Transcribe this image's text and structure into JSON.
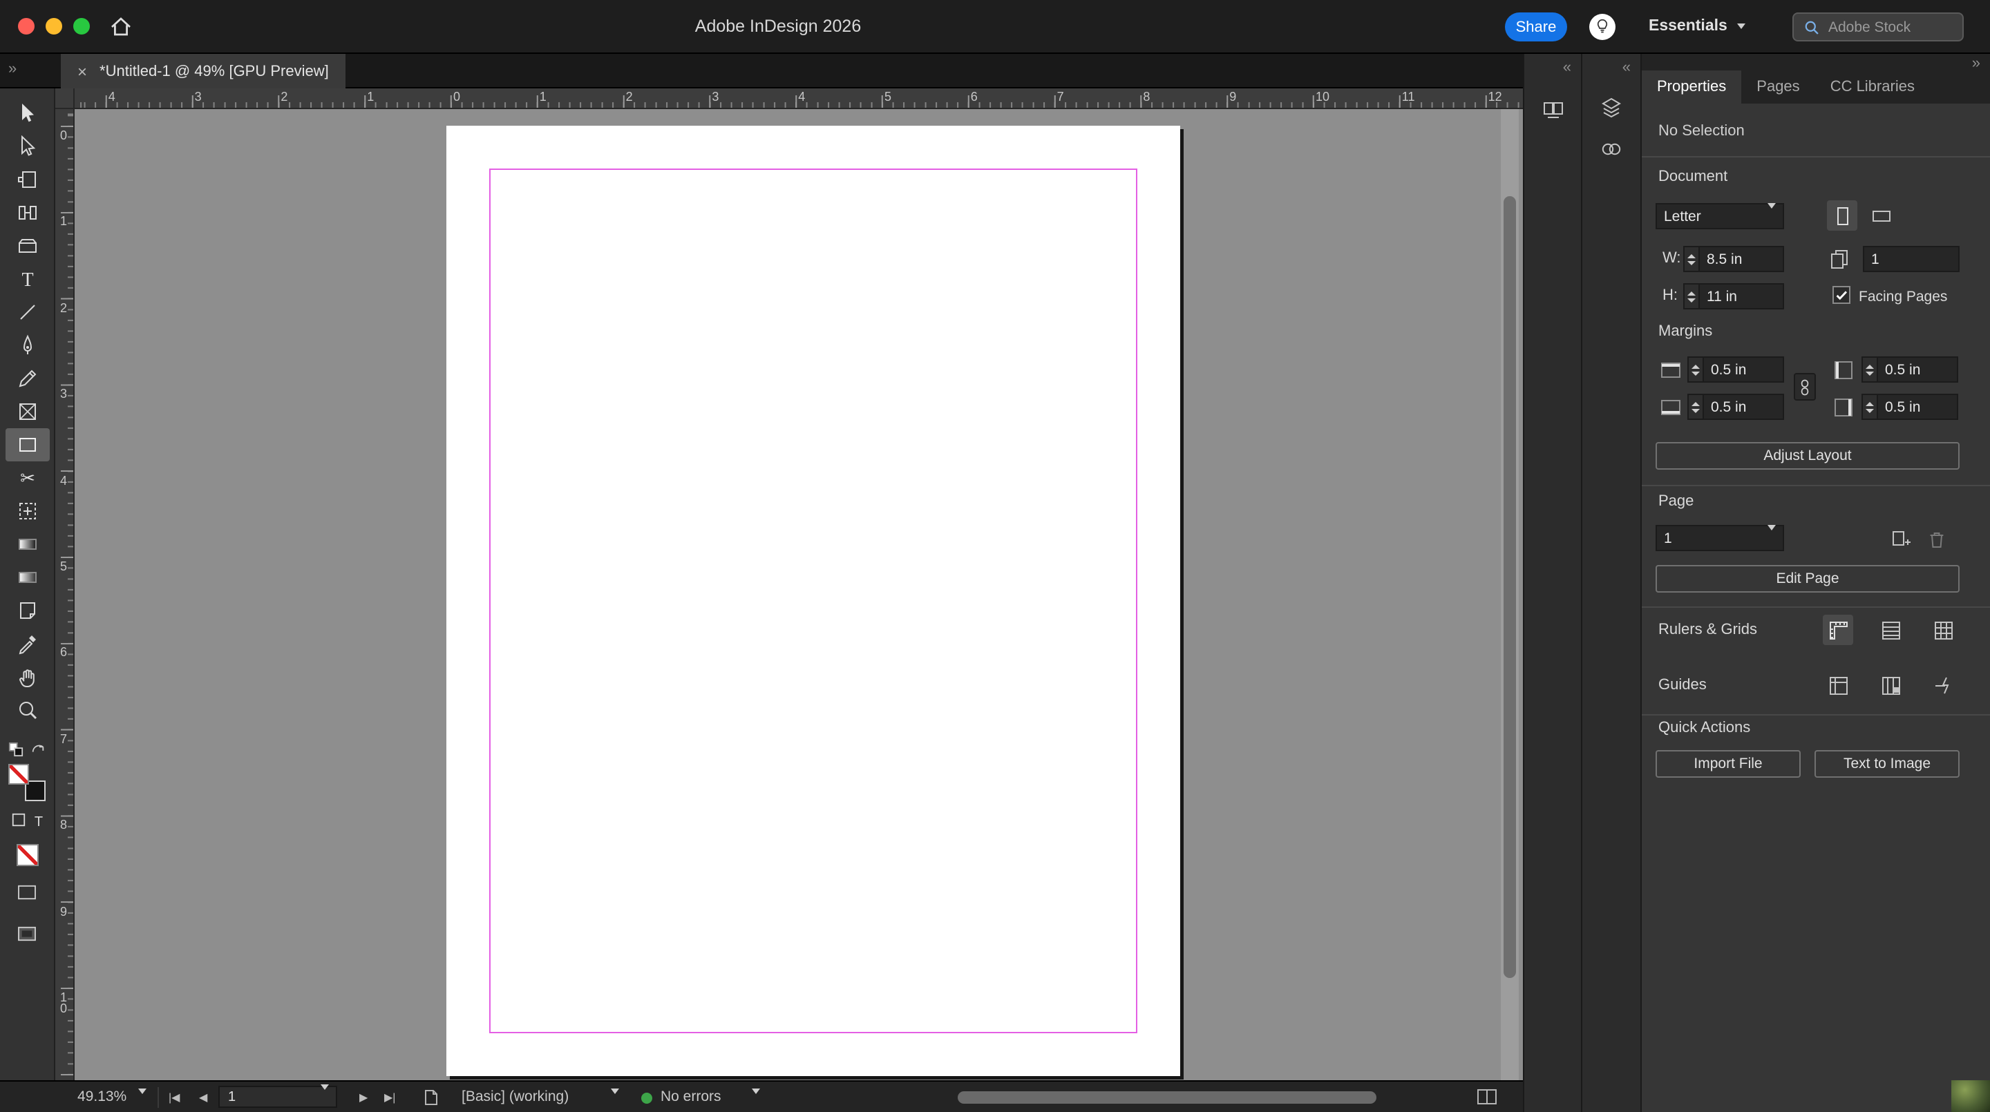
{
  "titlebar": {
    "title": "Adobe InDesign 2026",
    "share": "Share",
    "workspace": "Essentials",
    "stock_search_placeholder": "Adobe Stock"
  },
  "tabbar": {
    "document_tab": "*Untitled-1 @ 49% [GPU Preview]"
  },
  "icons": {
    "close-icon": "×",
    "dock-expand-icon": "»",
    "dock-collapse-icon": "«",
    "first-page-icon": "|◀",
    "prev-page-icon": "◀",
    "next-page-icon": "▶",
    "last-page-icon": "▶|"
  },
  "colors": {
    "accent_blue": "#1473e6",
    "margin_guide_magenta": "#e45fe4",
    "no_errors_green": "#3da549"
  },
  "toolbar": {
    "tools": [
      {
        "name": "selection-tool",
        "selected": false
      },
      {
        "name": "direct-selection-tool",
        "selected": false
      },
      {
        "name": "page-tool",
        "selected": false
      },
      {
        "name": "gap-tool",
        "selected": false
      },
      {
        "name": "content-collector-tool",
        "selected": false
      },
      {
        "name": "type-tool",
        "selected": false
      },
      {
        "name": "line-tool",
        "selected": false
      },
      {
        "name": "pen-tool",
        "selected": false
      },
      {
        "name": "pencil-tool",
        "selected": false
      },
      {
        "name": "rectangle-frame-tool",
        "selected": false
      },
      {
        "name": "rectangle-tool",
        "selected": true
      },
      {
        "name": "scissors-tool",
        "selected": false
      },
      {
        "name": "free-transform-tool",
        "selected": false
      },
      {
        "name": "gradient-swatch-tool",
        "selected": false
      },
      {
        "name": "gradient-feather-tool",
        "selected": false
      },
      {
        "name": "note-tool",
        "selected": false
      },
      {
        "name": "color-theme-tool",
        "selected": false
      },
      {
        "name": "hand-tool",
        "selected": false
      },
      {
        "name": "zoom-tool",
        "selected": false
      }
    ],
    "formatting_affects_text_glyph": "T"
  },
  "rulers": {
    "horizontal_labels": [
      "4",
      "3",
      "2",
      "1",
      "0",
      "1",
      "2",
      "3",
      "4",
      "5",
      "6",
      "7",
      "8",
      "9",
      "10",
      "11",
      "12"
    ],
    "vertical_labels": [
      "0",
      "1",
      "2",
      "3",
      "4",
      "5",
      "6",
      "7",
      "8",
      "9",
      "10"
    ]
  },
  "properties_panel": {
    "tabs": [
      {
        "label": "Properties",
        "active": true
      },
      {
        "label": "Pages",
        "active": false
      },
      {
        "label": "CC Libraries",
        "active": false
      }
    ],
    "selection_status": "No Selection",
    "document_section": {
      "title": "Document",
      "preset": "Letter",
      "width_label": "W:",
      "width_value": "8.5 in",
      "height_label": "H:",
      "height_value": "11 in",
      "pages_count": "1",
      "facing_pages_label": "Facing Pages",
      "facing_pages_checked": true
    },
    "margins_section": {
      "title": "Margins",
      "top": "0.5 in",
      "bottom": "0.5 in",
      "left": "0.5 in",
      "right": "0.5 in"
    },
    "adjust_layout_button": "Adjust Layout",
    "page_section": {
      "title": "Page",
      "current_page": "1",
      "edit_page_button": "Edit Page"
    },
    "rulers_grids_label": "Rulers & Grids",
    "guides_label": "Guides",
    "quick_actions": {
      "title": "Quick Actions",
      "import_file_button": "Import File",
      "text_to_image_button": "Text to Image"
    }
  },
  "statusbar": {
    "zoom_level": "49.13%",
    "page_number": "1",
    "preflight_profile": "[Basic] (working)",
    "preflight_status": "No errors"
  }
}
